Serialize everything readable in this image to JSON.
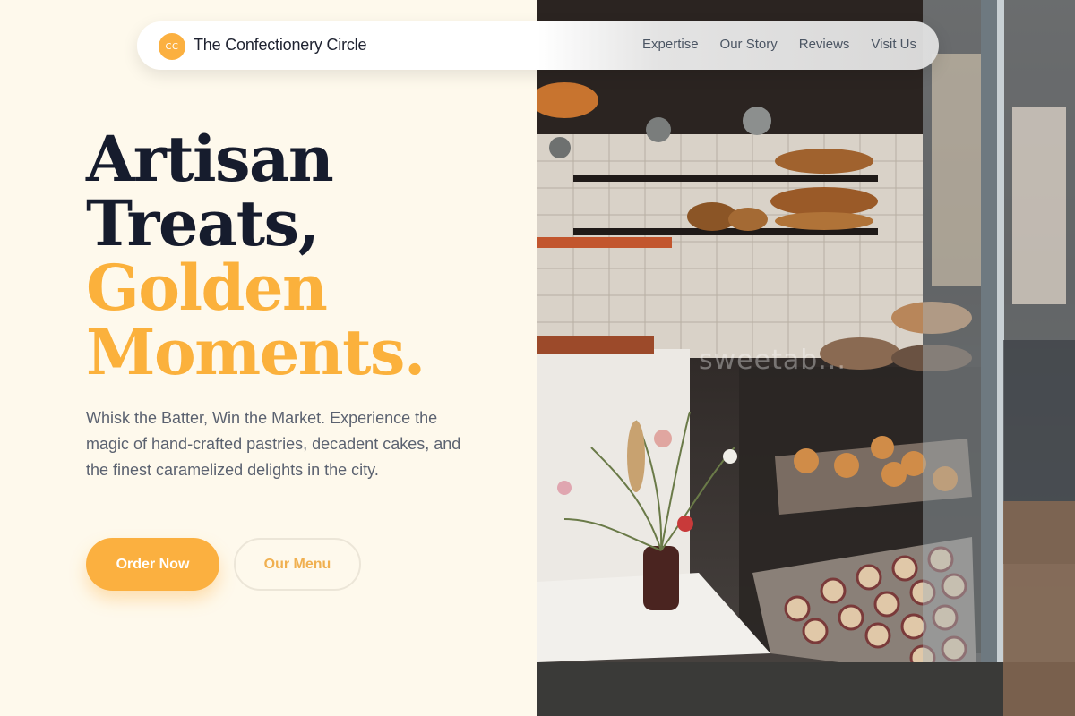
{
  "brand": {
    "initials": "CC",
    "name": "The Confectionery Circle"
  },
  "nav": {
    "links": [
      "Expertise",
      "Our Story",
      "Reviews",
      "Visit Us"
    ]
  },
  "hero": {
    "headline_dark_1": "Artisan",
    "headline_dark_2": "Treats,",
    "headline_gold_1": "Golden",
    "headline_gold_2": "Moments.",
    "lede": "Whisk the Batter, Win the Market. Experience the magic of hand-crafted pastries, decadent cakes, and the finest caramelized delights in the city.",
    "cta_primary": "Order Now",
    "cta_secondary": "Our Menu"
  },
  "photo": {
    "watermark": "sweetab..."
  },
  "colors": {
    "accent": "#fbb040",
    "dark_text": "#161c2d",
    "cream_bg": "#fef9ec",
    "body_text": "#5b6270"
  }
}
